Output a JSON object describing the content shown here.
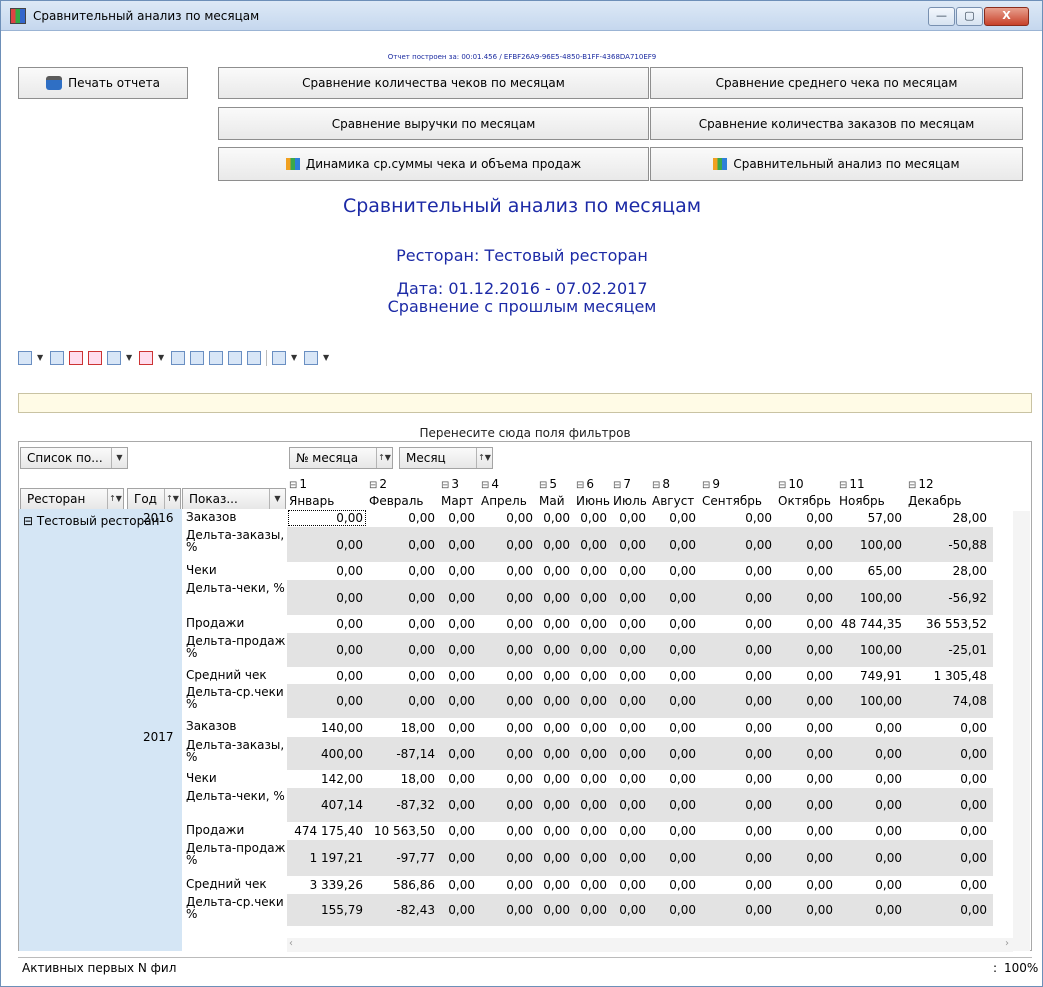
{
  "window": {
    "title": "Сравнительный анализ по месяцам",
    "min": "—",
    "max": "▢",
    "close": "X"
  },
  "build_info": "Отчет построен за: 00:01.456 / EFBF26A9-96E5-4850-B1FF-4368DA710EF9",
  "buttons": {
    "print": "Печать отчета",
    "checks": "Сравнение количества чеков по месяцам",
    "avg_check": "Сравнение среднего чека по месяцам",
    "revenue": "Сравнение выручки по месяцам",
    "orders": "Сравнение количества заказов по месяцам",
    "dynamics": "Динамика ср.суммы чека и объема продаж",
    "comparative": "Сравнительный анализ по месяцам"
  },
  "report": {
    "title": "Сравнительный анализ по месяцам",
    "restaurant": "Ресторан: Тестовый ресторан",
    "date": "Дата: 01.12.2016 - 07.02.2017",
    "comparison": "Сравнение с прошлым месяцем"
  },
  "drop_hint": "Перенесите сюда поля фильтров",
  "fields": {
    "list": "Список по...",
    "month_num": "№ месяца",
    "month": "Месяц",
    "restaurant": "Ресторан",
    "year": "Год",
    "measure": "Показ..."
  },
  "columns": [
    {
      "num": "1",
      "name": "Январь"
    },
    {
      "num": "2",
      "name": "Февраль"
    },
    {
      "num": "3",
      "name": "Март"
    },
    {
      "num": "4",
      "name": "Апрель"
    },
    {
      "num": "5",
      "name": "Май"
    },
    {
      "num": "6",
      "name": "Июнь"
    },
    {
      "num": "7",
      "name": "Июль"
    },
    {
      "num": "8",
      "name": "Август"
    },
    {
      "num": "9",
      "name": "Сентябрь"
    },
    {
      "num": "10",
      "name": "Октябрь"
    },
    {
      "num": "11",
      "name": "Ноябрь"
    },
    {
      "num": "12",
      "name": "Декабрь"
    }
  ],
  "row_restaurant": "Тестовый ресторан",
  "years": [
    "2016",
    "2017"
  ],
  "rows": [
    {
      "year": "2016",
      "measure": "Заказов",
      "values": [
        "0,00",
        "0,00",
        "0,00",
        "0,00",
        "0,00",
        "0,00",
        "0,00",
        "0,00",
        "0,00",
        "0,00",
        "57,00",
        "28,00"
      ]
    },
    {
      "year": "2016",
      "measure": "Дельта-заказы, %",
      "values": [
        "0,00",
        "0,00",
        "0,00",
        "0,00",
        "0,00",
        "0,00",
        "0,00",
        "0,00",
        "0,00",
        "0,00",
        "100,00",
        "-50,88"
      ]
    },
    {
      "year": "2016",
      "measure": "Чеки",
      "values": [
        "0,00",
        "0,00",
        "0,00",
        "0,00",
        "0,00",
        "0,00",
        "0,00",
        "0,00",
        "0,00",
        "0,00",
        "65,00",
        "28,00"
      ]
    },
    {
      "year": "2016",
      "measure": "Дельта-чеки, %",
      "values": [
        "0,00",
        "0,00",
        "0,00",
        "0,00",
        "0,00",
        "0,00",
        "0,00",
        "0,00",
        "0,00",
        "0,00",
        "100,00",
        "-56,92"
      ]
    },
    {
      "year": "2016",
      "measure": "Продажи",
      "values": [
        "0,00",
        "0,00",
        "0,00",
        "0,00",
        "0,00",
        "0,00",
        "0,00",
        "0,00",
        "0,00",
        "0,00",
        "48 744,35",
        "36 553,52"
      ]
    },
    {
      "year": "2016",
      "measure": "Дельта-продаж %",
      "values": [
        "0,00",
        "0,00",
        "0,00",
        "0,00",
        "0,00",
        "0,00",
        "0,00",
        "0,00",
        "0,00",
        "0,00",
        "100,00",
        "-25,01"
      ]
    },
    {
      "year": "2016",
      "measure": "Средний чек",
      "values": [
        "0,00",
        "0,00",
        "0,00",
        "0,00",
        "0,00",
        "0,00",
        "0,00",
        "0,00",
        "0,00",
        "0,00",
        "749,91",
        "1 305,48"
      ]
    },
    {
      "year": "2016",
      "measure": "Дельта-ср.чеки %",
      "values": [
        "0,00",
        "0,00",
        "0,00",
        "0,00",
        "0,00",
        "0,00",
        "0,00",
        "0,00",
        "0,00",
        "0,00",
        "100,00",
        "74,08"
      ]
    },
    {
      "year": "2017",
      "measure": "Заказов",
      "values": [
        "140,00",
        "18,00",
        "0,00",
        "0,00",
        "0,00",
        "0,00",
        "0,00",
        "0,00",
        "0,00",
        "0,00",
        "0,00",
        "0,00"
      ]
    },
    {
      "year": "2017",
      "measure": "Дельта-заказы, %",
      "values": [
        "400,00",
        "-87,14",
        "0,00",
        "0,00",
        "0,00",
        "0,00",
        "0,00",
        "0,00",
        "0,00",
        "0,00",
        "0,00",
        "0,00"
      ]
    },
    {
      "year": "2017",
      "measure": "Чеки",
      "values": [
        "142,00",
        "18,00",
        "0,00",
        "0,00",
        "0,00",
        "0,00",
        "0,00",
        "0,00",
        "0,00",
        "0,00",
        "0,00",
        "0,00"
      ]
    },
    {
      "year": "2017",
      "measure": "Дельта-чеки, %",
      "values": [
        "407,14",
        "-87,32",
        "0,00",
        "0,00",
        "0,00",
        "0,00",
        "0,00",
        "0,00",
        "0,00",
        "0,00",
        "0,00",
        "0,00"
      ]
    },
    {
      "year": "2017",
      "measure": "Продажи",
      "values": [
        "474 175,40",
        "10 563,50",
        "0,00",
        "0,00",
        "0,00",
        "0,00",
        "0,00",
        "0,00",
        "0,00",
        "0,00",
        "0,00",
        "0,00"
      ]
    },
    {
      "year": "2017",
      "measure": "Дельта-продаж %",
      "values": [
        "1 197,21",
        "-97,77",
        "0,00",
        "0,00",
        "0,00",
        "0,00",
        "0,00",
        "0,00",
        "0,00",
        "0,00",
        "0,00",
        "0,00"
      ]
    },
    {
      "year": "2017",
      "measure": "Средний чек",
      "values": [
        "3 339,26",
        "586,86",
        "0,00",
        "0,00",
        "0,00",
        "0,00",
        "0,00",
        "0,00",
        "0,00",
        "0,00",
        "0,00",
        "0,00"
      ]
    },
    {
      "year": "2017",
      "measure": "Дельта-ср.чеки %",
      "values": [
        "155,79",
        "-82,43",
        "0,00",
        "0,00",
        "0,00",
        "0,00",
        "0,00",
        "0,00",
        "0,00",
        "0,00",
        "0,00",
        "0,00"
      ]
    }
  ],
  "status": {
    "left": "Активных первых N фил",
    "colon": ":",
    "zoom": "100%"
  },
  "colors": {
    "title_blue": "#1c2aa6",
    "row_header_bg": "#d5e6f5",
    "alt_row_bg": "#e3e3e3"
  }
}
